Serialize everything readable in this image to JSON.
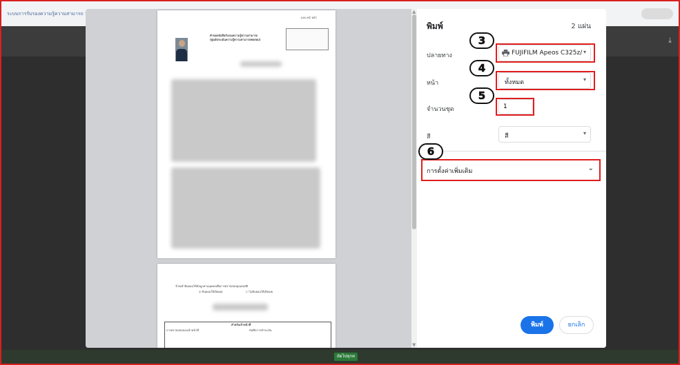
{
  "background": {
    "tab_text": "ระบบการรับรองความรู้ความสามารถ   ระดับชั้น",
    "bottom_button": "ถัดไปทุกท"
  },
  "preview": {
    "doc_header": "แบบ พ1 หน้า",
    "doc_title_line1": "คำขอหนังสือรับรองความรู้ความสามารถ",
    "doc_title_line2": "(ศูนย์ประเมินความรู้ความสามารถทดสอบ)",
    "page2_line1": "ข้าพเจ้ายินยอมให้ข้อมูลส่วนบุคคลเพื่อการตรวจสอบคุณสมบัติ",
    "page2_check1": "ยินยอมให้เปิดเผย",
    "page2_check2": "ไม่ยินยอมให้เปิดเผย",
    "page2_table_header": "สำหรับเจ้าหน้าที่",
    "page2_table_col1": "การตรวจสอบของเจ้าหน้าที่",
    "page2_table_col2": "บันทึกการชำระเงิน"
  },
  "print_panel": {
    "title": "พิมพ์",
    "sheet_count": "2 แผ่น",
    "destination_label": "ปลายทาง",
    "destination_value": "FUJIFILM Apeos C325z/",
    "pages_label": "หน้า",
    "pages_value": "ทั้งหมด",
    "copies_label": "จำนวนชุด",
    "copies_value": "1",
    "color_label": "สี",
    "color_value": "สี",
    "more_settings": "การตั้งค่าเพิ่มเติม",
    "print_button": "พิมพ์",
    "cancel_button": "ยกเลิก"
  },
  "annotations": {
    "step3": "3",
    "step4": "4",
    "step5": "5",
    "step6": "6",
    "highlight_color": "#e01c1c"
  },
  "colors": {
    "accent": "#1a73e8",
    "border_red": "#d92020"
  }
}
